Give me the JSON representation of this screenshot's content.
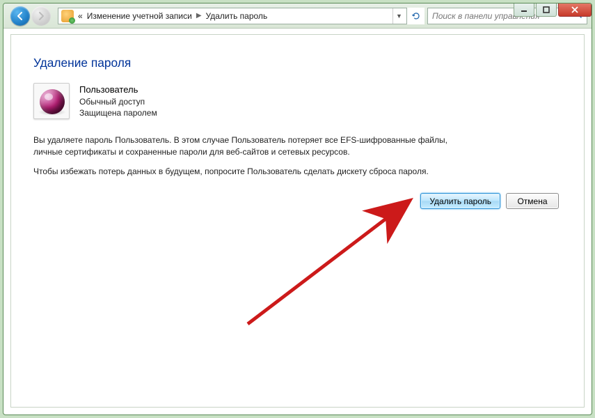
{
  "breadcrumb": {
    "prefix": "«",
    "level1": "Изменение учетной записи",
    "level2": "Удалить пароль"
  },
  "search": {
    "placeholder": "Поиск в панели управления"
  },
  "page": {
    "title": "Удаление пароля",
    "user_name": "Пользователь",
    "user_access": "Обычный доступ",
    "user_protected": "Защищена паролем",
    "para1": "Вы удаляете пароль Пользователь. В этом случае Пользователь потеряет все EFS-шифрованные файлы, личные сертификаты и сохраненные пароли для веб-сайтов и сетевых ресурсов.",
    "para2": "Чтобы избежать потерь данных в будущем, попросите Пользователь сделать дискету сброса пароля."
  },
  "buttons": {
    "delete": "Удалить пароль",
    "cancel": "Отмена"
  }
}
